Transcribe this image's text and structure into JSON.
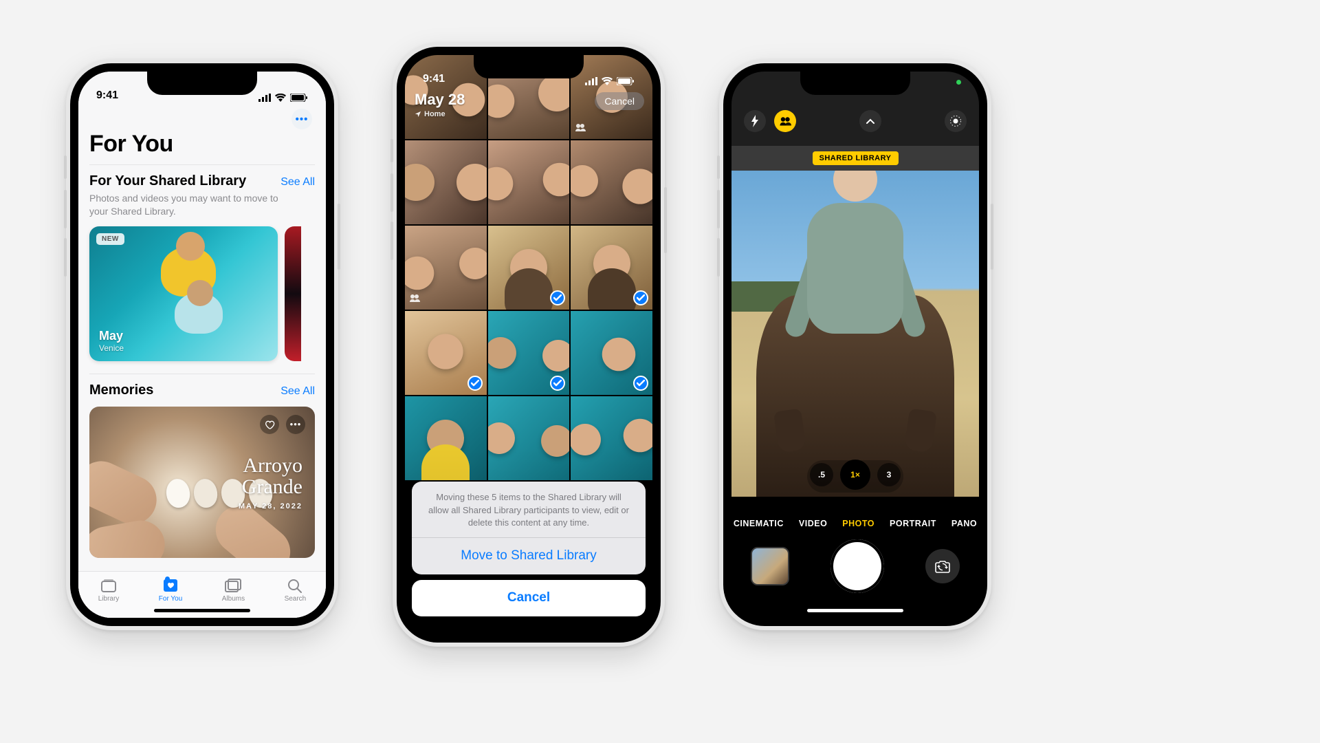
{
  "status_time": "9:41",
  "phone1": {
    "page_title": "For You",
    "shared_section": {
      "title": "For Your Shared Library",
      "see_all": "See All",
      "subtitle": "Photos and videos you may want to move to your Shared Library."
    },
    "card": {
      "new_badge": "NEW",
      "title": "May",
      "subtitle": "Venice"
    },
    "memories_section": {
      "title": "Memories",
      "see_all": "See All"
    },
    "memory": {
      "title_line1": "Arroyo",
      "title_line2": "Grande",
      "date": "MAY 28, 2022"
    },
    "tabs": {
      "library": "Library",
      "for_you": "For You",
      "albums": "Albums",
      "search": "Search"
    }
  },
  "phone2": {
    "date": "May 28",
    "location": "Home",
    "cancel_pill": "Cancel",
    "sheet_message": "Moving these 5 items to the Shared Library will allow all Shared Library participants to view, edit or delete this content at any time.",
    "move_action": "Move to Shared Library",
    "cancel_action": "Cancel",
    "selected_count": 5
  },
  "phone3": {
    "badge": "SHARED LIBRARY",
    "zoom": {
      "wide": ".5",
      "one": "1×",
      "tele": "3"
    },
    "modes": {
      "cinematic": "CINEMATIC",
      "video": "VIDEO",
      "photo": "PHOTO",
      "portrait": "PORTRAIT",
      "pano": "PANO"
    }
  }
}
